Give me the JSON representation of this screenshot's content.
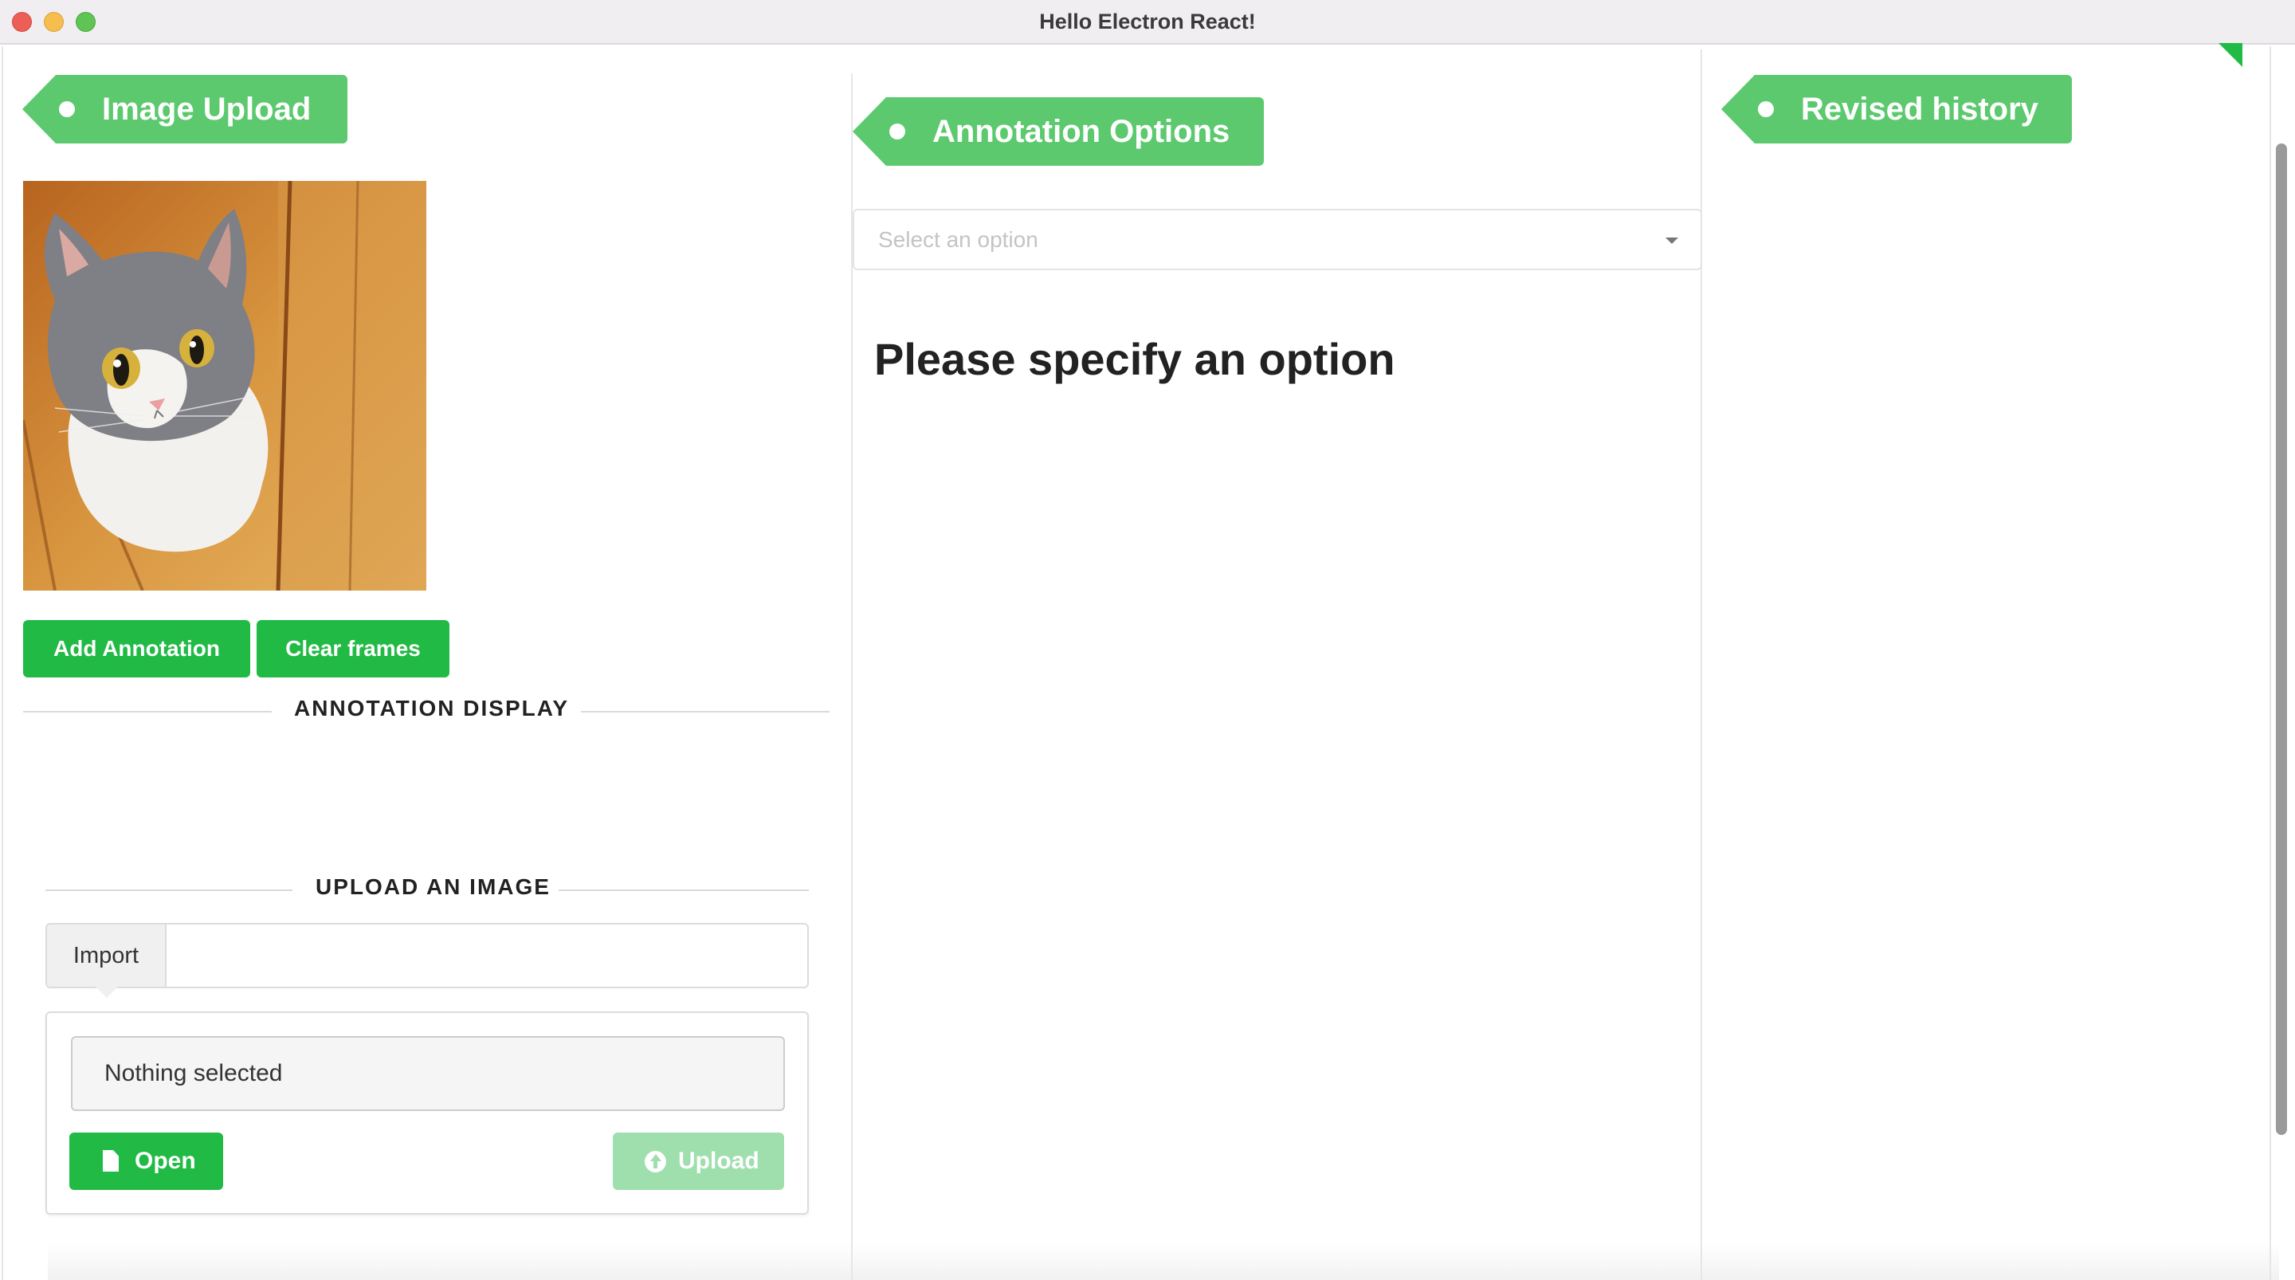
{
  "window": {
    "title": "Hello Electron React!"
  },
  "left": {
    "ribbon": "Image Upload",
    "buttons": {
      "add_annotation": "Add Annotation",
      "clear_frames": "Clear frames"
    },
    "annotation_display_label": "ANNOTATION DISPLAY",
    "upload_section_label": "UPLOAD AN IMAGE",
    "import_label": "Import",
    "file_status": "Nothing selected",
    "open_button": "Open",
    "upload_button": "Upload"
  },
  "middle": {
    "ribbon": "Annotation Options",
    "select_placeholder": "Select an option",
    "message": "Please specify an option"
  },
  "right": {
    "ribbon": "Revised history"
  },
  "colors": {
    "ribbon": "#5cc96e",
    "button": "#21ba45",
    "button_disabled": "#9fdfae"
  },
  "icons": [
    "file-icon",
    "upload-icon",
    "chevron-down-icon"
  ]
}
